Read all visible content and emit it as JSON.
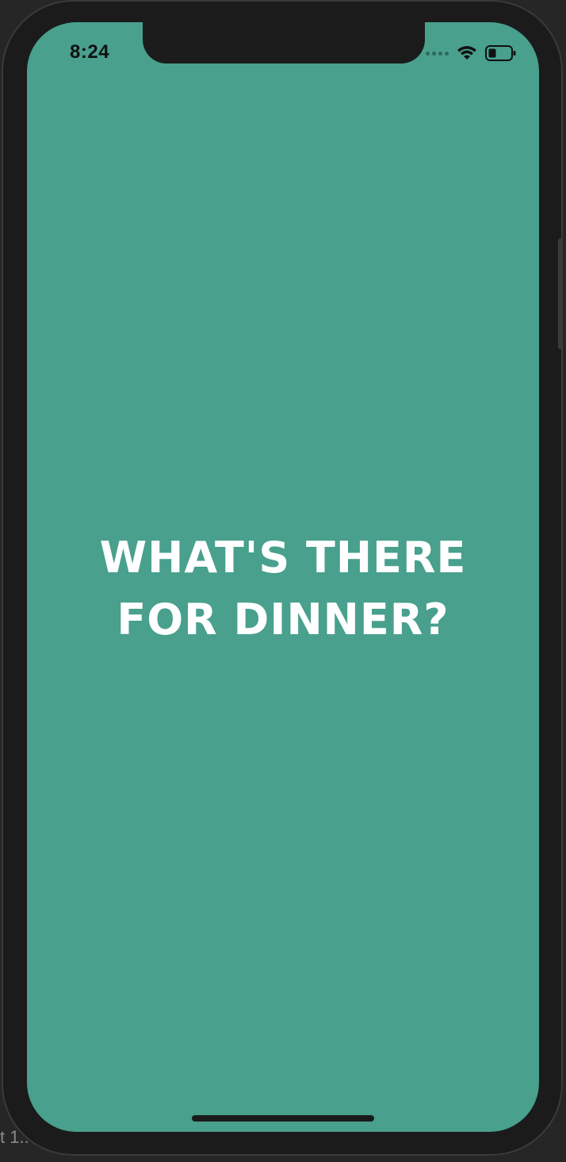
{
  "status_bar": {
    "time": "8:24",
    "icons": [
      "cellular-signal-icon",
      "wifi-icon",
      "battery-icon"
    ]
  },
  "main": {
    "headline_line1": "WHAT'S THERE",
    "headline_line2": "FOR DINNER?"
  },
  "backdrop": {
    "partial_text": "t 1.:"
  },
  "colors": {
    "screen_background": "#48a08d",
    "headline_text": "#ffffff",
    "frame": "#1b1b1b"
  }
}
